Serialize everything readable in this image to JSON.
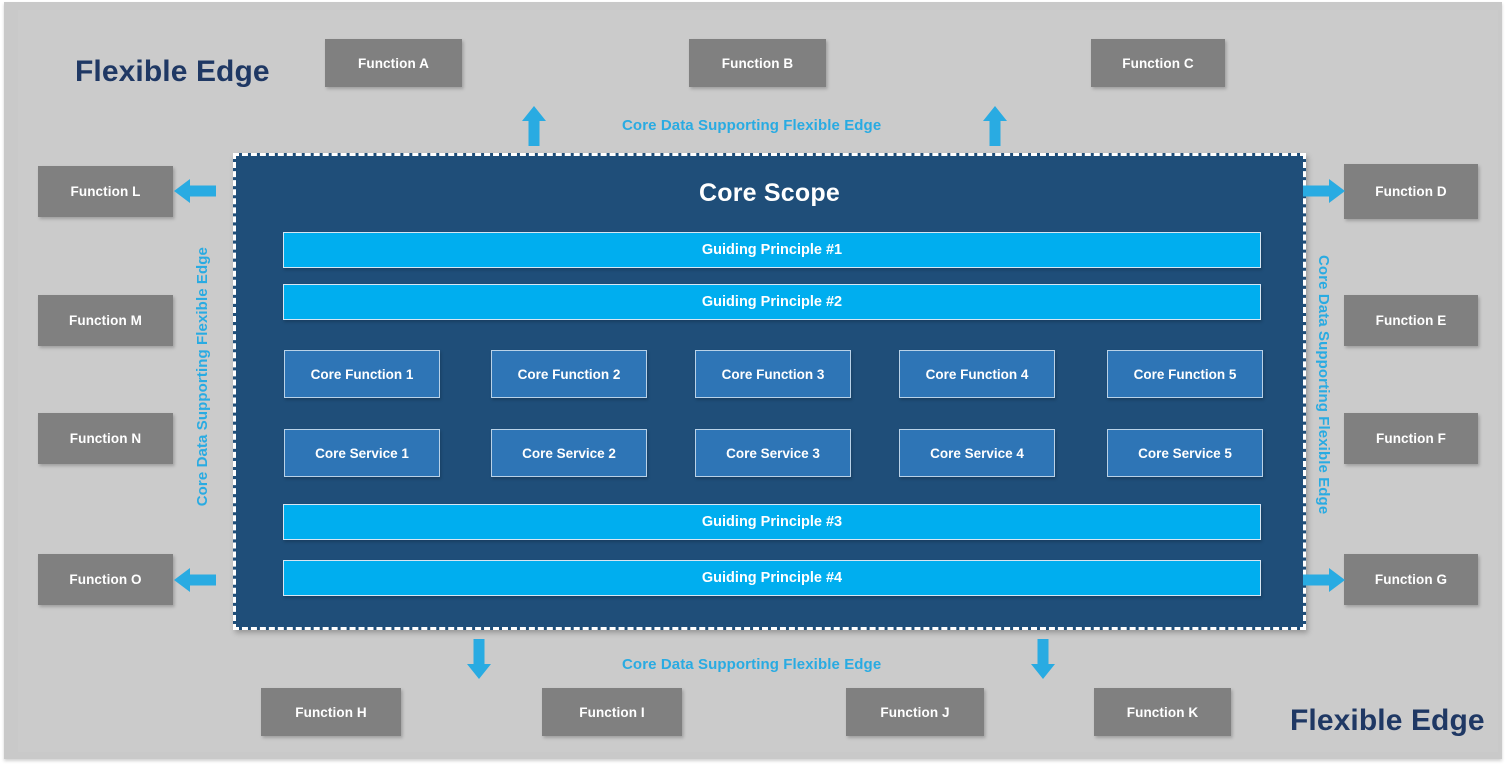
{
  "diagram": {
    "title_left": "Flexible Edge",
    "title_right": "Flexible Edge",
    "core_scope_title": "Core Scope",
    "flow_label": "Core Data Supporting Flexible Edge",
    "colors": {
      "background": "#cbcbcb",
      "core_scope": "#1f4e79",
      "guiding_principle": "#00aeef",
      "core_box": "#2e75b6",
      "function_box": "#808080",
      "accent_blue": "#29abe2",
      "title_navy": "#1f3864"
    },
    "edge_labels": {
      "top": "Core Data Supporting Flexible Edge",
      "bottom": "Core Data Supporting Flexible Edge",
      "left": "Core Data Supporting Flexible Edge",
      "right": "Core Data Supporting Flexible Edge"
    },
    "guiding_principles": [
      "Guiding Principle #1",
      "Guiding Principle #2",
      "Guiding Principle #3",
      "Guiding Principle #4"
    ],
    "core_functions": [
      "Core Function 1",
      "Core Function 2",
      "Core Function 3",
      "Core Function 4",
      "Core Function 5"
    ],
    "core_services": [
      "Core Service 1",
      "Core Service 2",
      "Core Service 3",
      "Core Service 4",
      "Core Service 5"
    ],
    "functions_top": [
      "Function A",
      "Function B",
      "Function C"
    ],
    "functions_right": [
      "Function D",
      "Function E",
      "Function F",
      "Function G"
    ],
    "functions_bottom": [
      "Function H",
      "Function I",
      "Function J",
      "Function K"
    ],
    "functions_left": [
      "Function L",
      "Function M",
      "Function N",
      "Function O"
    ],
    "arrows": [
      {
        "name": "arrow-up-left",
        "direction": "up"
      },
      {
        "name": "arrow-up-right",
        "direction": "up"
      },
      {
        "name": "arrow-right-top",
        "direction": "right"
      },
      {
        "name": "arrow-right-bottom",
        "direction": "right"
      },
      {
        "name": "arrow-down-left",
        "direction": "down"
      },
      {
        "name": "arrow-down-right",
        "direction": "down"
      },
      {
        "name": "arrow-left-top",
        "direction": "left"
      },
      {
        "name": "arrow-left-bottom",
        "direction": "left"
      }
    ]
  }
}
